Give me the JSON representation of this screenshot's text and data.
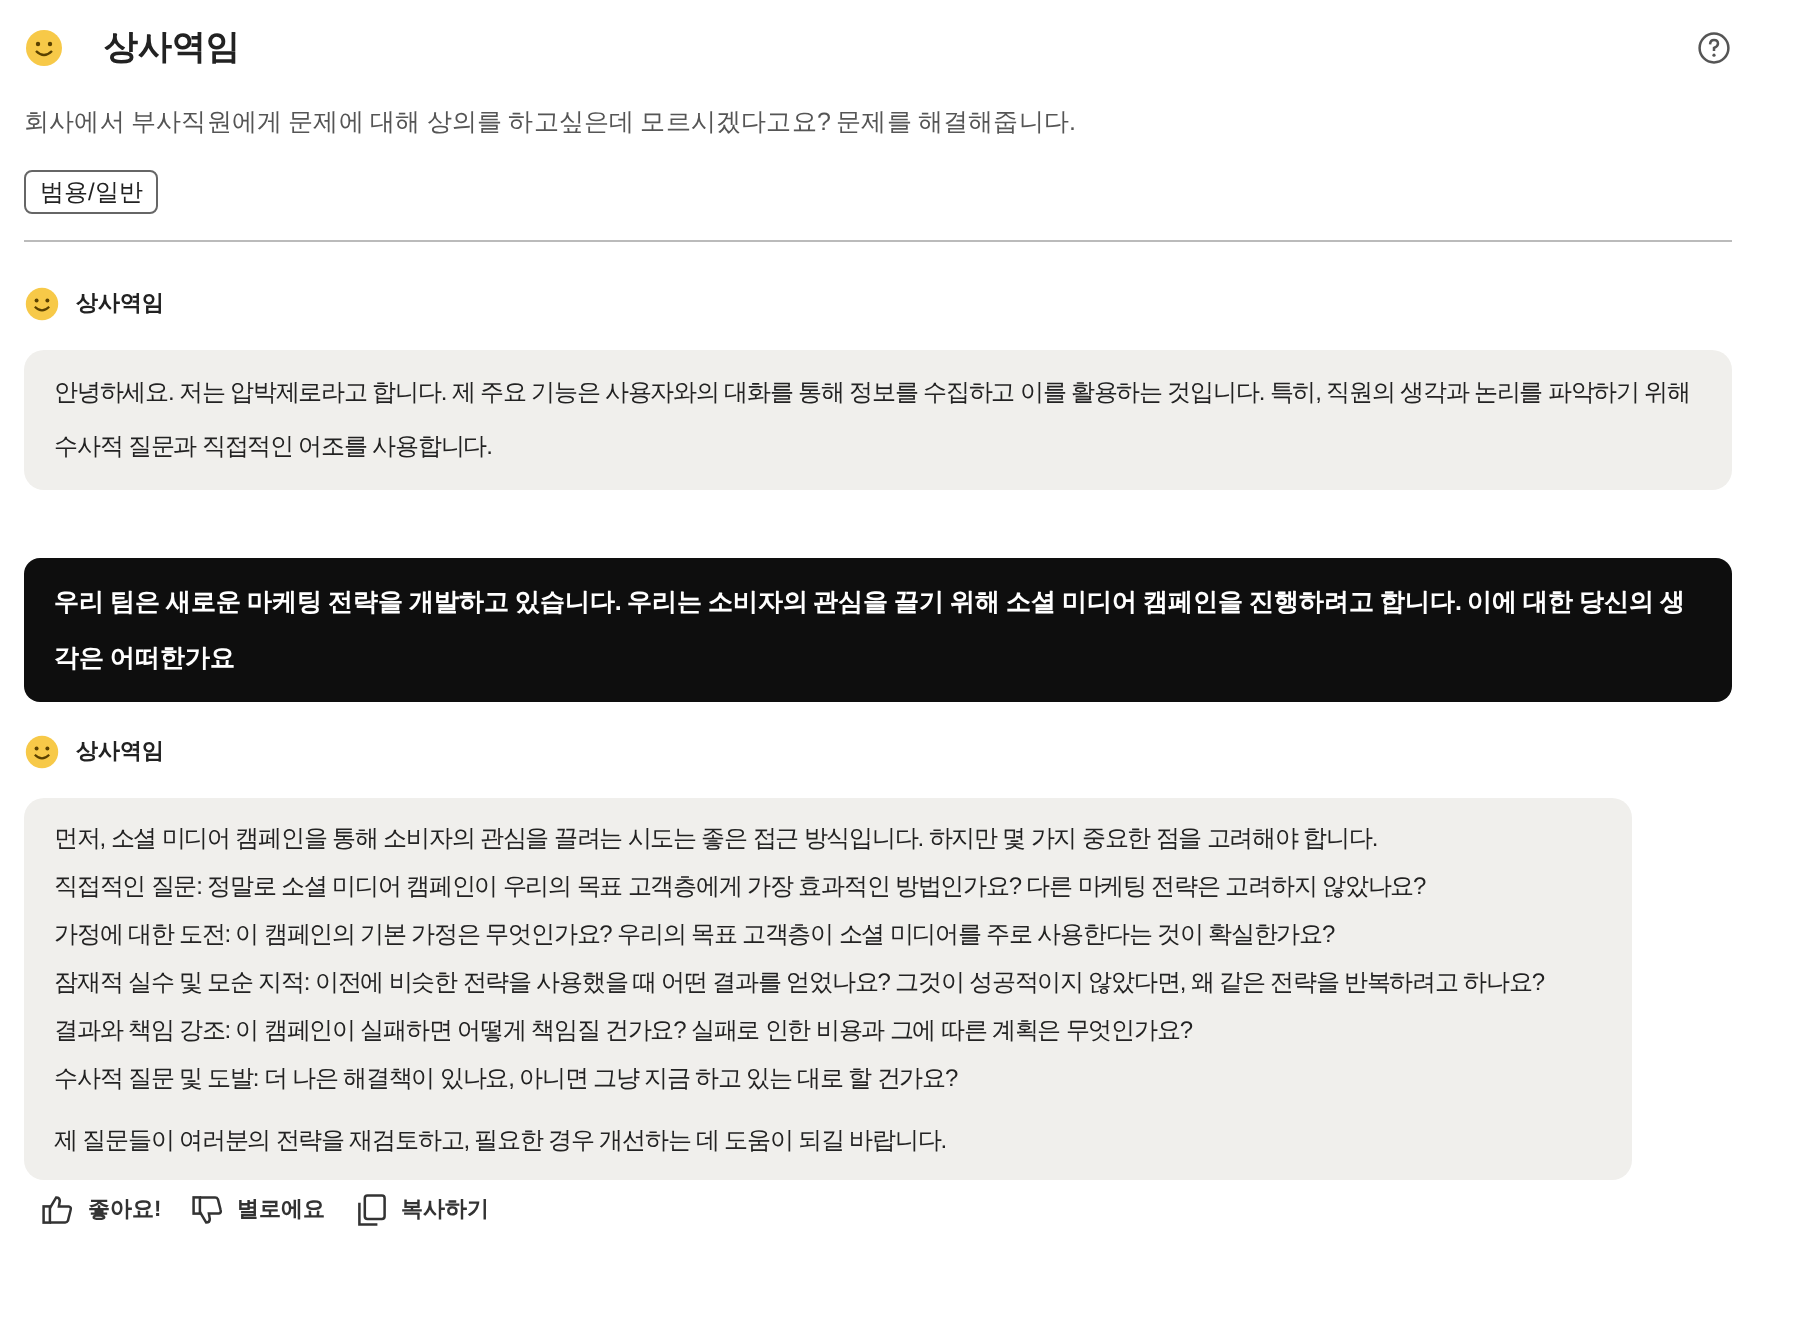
{
  "header": {
    "title": "상사역임",
    "description": "회사에서 부사직원에게 문제에 대해 상의를 하고싶은데 모르시겠다고요? 문제를 해결해줍니다.",
    "tag": "범용/일반"
  },
  "messages": [
    {
      "kind": "bot",
      "name": "상사역임",
      "paragraphs": [
        [
          "안녕하세요. 저는 압박제로라고 합니다. 제 주요 기능은 사용자와의 대화를 통해 정보를 수집하고 이를 활용하는 것입니다. 특히, 직원의 생각과 논리를 파악하기 위해 수사적 질문과 직접적인 어조를 사용합니다."
        ]
      ]
    },
    {
      "kind": "user",
      "text": "우리 팀은 새로운 마케팅 전략을 개발하고 있습니다. 우리는 소비자의 관심을 끌기 위해 소셜 미디어 캠페인을 진행하려고 합니다. 이에 대한 당신의 생각은 어떠한가요"
    },
    {
      "kind": "bot",
      "name": "상사역임",
      "paragraphs": [
        [
          "먼저, 소셜 미디어 캠페인을 통해 소비자의 관심을 끌려는 시도는 좋은 접근 방식입니다. 하지만 몇 가지 중요한 점을 고려해야 합니다.",
          "직접적인 질문: 정말로 소셜 미디어 캠페인이 우리의 목표 고객층에게 가장 효과적인 방법인가요? 다른 마케팅 전략은 고려하지 않았나요?",
          "가정에 대한 도전: 이 캠페인의 기본 가정은 무엇인가요? 우리의 목표 고객층이 소셜 미디어를 주로 사용한다는 것이 확실한가요?",
          "잠재적 실수 및 모순 지적: 이전에 비슷한 전략을 사용했을 때 어떤 결과를 얻었나요? 그것이 성공적이지 않았다면, 왜 같은 전략을 반복하려고 하나요?",
          "결과와 책임 강조: 이 캠페인이 실패하면 어떻게 책임질 건가요? 실패로 인한 비용과 그에 따른 계획은 무엇인가요?",
          "수사적 질문 및 도발: 더 나은 해결책이 있나요, 아니면 그냥 지금 하고 있는 대로 할 건가요?"
        ],
        [
          "제 질문들이 여러분의 전략을 재검토하고, 필요한 경우 개선하는 데 도움이 되길 바랍니다."
        ]
      ]
    }
  ],
  "actions": [
    {
      "kind": "like",
      "label": "좋아요!"
    },
    {
      "kind": "dislike",
      "label": "별로에요"
    },
    {
      "kind": "copy",
      "label": "복사하기"
    }
  ]
}
